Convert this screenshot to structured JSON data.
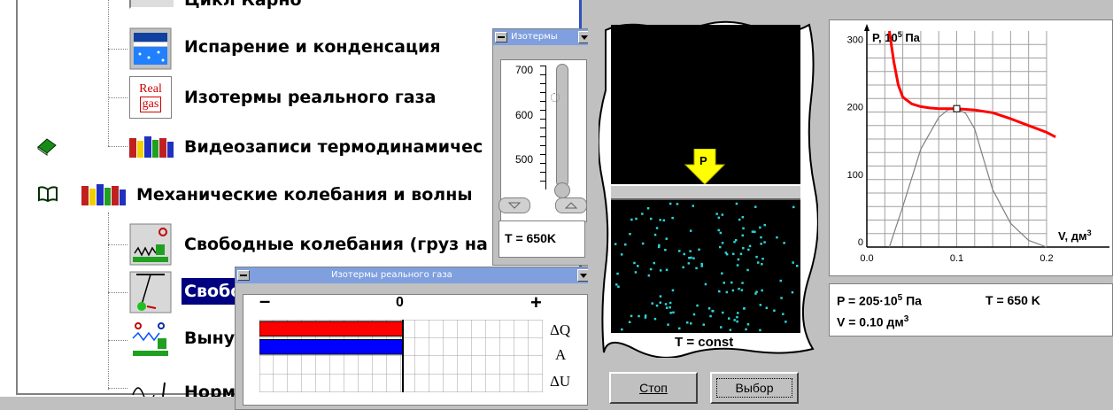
{
  "tree": {
    "items": [
      {
        "label": "Цикл Карно"
      },
      {
        "label": "Испарение и конденсация"
      },
      {
        "label": "Изотермы реального газа"
      },
      {
        "label": "Видеозаписи термодинамичес"
      },
      {
        "label": "Механические колебания и волны"
      },
      {
        "label": "Свободные колебания (груз на"
      },
      {
        "label": "Свобо"
      },
      {
        "label": "Выну"
      },
      {
        "label": "Норм"
      }
    ],
    "icon_real_gas": {
      "line1": "Real",
      "line2": "gas"
    }
  },
  "thermometer_window": {
    "title": "Изотермы",
    "ticks": [
      "700",
      "600",
      "500"
    ],
    "temperature_text": "T = 650K",
    "slider_level_fraction": 0.82
  },
  "energy_window": {
    "title": "Изотермы реального газа",
    "minus": "–",
    "zero": "0",
    "plus": "+",
    "labels": [
      "ΔQ",
      "A",
      "ΔU"
    ],
    "bars": [
      {
        "name": "ΔQ",
        "color": "#ff0000",
        "fraction": 1.0
      },
      {
        "name": "A",
        "color": "#0000ff",
        "fraction": 1.0
      },
      {
        "name": "ΔU",
        "color": "#ffffff",
        "fraction": 0.0
      }
    ]
  },
  "cylinder": {
    "piston_label": "P",
    "caption": "T = const",
    "molecule_color": "#2cd4d4"
  },
  "buttons": {
    "stop": "Стоп",
    "select": "Выбор"
  },
  "chart_data": {
    "type": "line",
    "ylabel_prefix": "P, 10",
    "ylabel_exp": "5",
    "ylabel_unit": " Па",
    "xlabel_prefix": "V, дм",
    "xlabel_exp": "3",
    "x_ticks": [
      "0.0",
      "0.1",
      "0.2"
    ],
    "y_ticks": [
      "0",
      "100",
      "200",
      "300"
    ],
    "xlim": [
      0,
      0.27
    ],
    "ylim": [
      0,
      320
    ],
    "grid": true,
    "series": [
      {
        "color": "#ff0000",
        "x": [
          0.025,
          0.03,
          0.035,
          0.04,
          0.05,
          0.06,
          0.07,
          0.08,
          0.09,
          0.1,
          0.12,
          0.14,
          0.16,
          0.18,
          0.2,
          0.21
        ],
        "y": [
          322,
          275,
          240,
          222,
          212,
          208,
          206,
          205,
          205,
          205,
          203,
          199,
          190,
          180,
          170,
          163
        ]
      },
      {
        "color": "#808080",
        "x": [
          0.025,
          0.04,
          0.06,
          0.08,
          0.09,
          0.1,
          0.11,
          0.12,
          0.13,
          0.14,
          0.16,
          0.18,
          0.2
        ],
        "y": [
          0,
          60,
          145,
          192,
          203,
          205,
          198,
          175,
          130,
          85,
          35,
          10,
          0
        ]
      }
    ],
    "marker": {
      "x": 0.1,
      "y": 205
    }
  },
  "readout": {
    "pressure_prefix": "P = 205·10",
    "pressure_exp": "5",
    "pressure_unit": " Па",
    "temperature": "T = 650 K",
    "volume_prefix": "V = 0.10 дм",
    "volume_exp": "3"
  }
}
